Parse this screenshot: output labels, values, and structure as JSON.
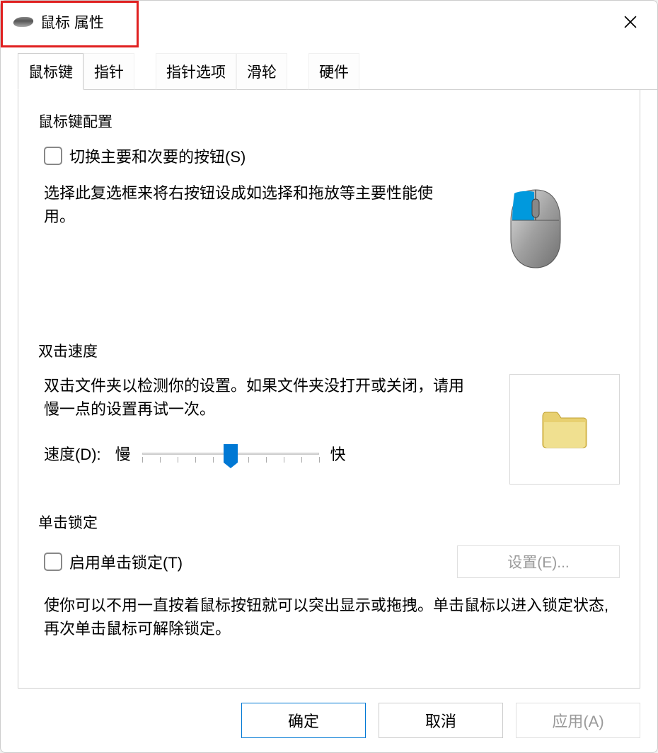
{
  "window": {
    "title": "鼠标 属性"
  },
  "tabs": [
    {
      "label": "鼠标键",
      "active": true
    },
    {
      "label": "指针",
      "active": false
    },
    {
      "label": "指针选项",
      "active": false
    },
    {
      "label": "滑轮",
      "active": false
    },
    {
      "label": "硬件",
      "active": false
    }
  ],
  "buttons_config": {
    "title": "鼠标键配置",
    "checkbox_label": "切换主要和次要的按钮(S)",
    "description": "选择此复选框来将右按钮设成如选择和拖放等主要性能使用。"
  },
  "double_click": {
    "title": "双击速度",
    "description": "双击文件夹以检测你的设置。如果文件夹没打开或关闭，请用慢一点的设置再试一次。",
    "speed_label": "速度(D):",
    "slow_label": "慢",
    "fast_label": "快",
    "slider_value": 5,
    "slider_max": 10
  },
  "click_lock": {
    "title": "单击锁定",
    "checkbox_label": "启用单击锁定(T)",
    "settings_label": "设置(E)...",
    "description": "使你可以不用一直按着鼠标按钮就可以突出显示或拖拽。单击鼠标以进入锁定状态,再次单击鼠标可解除锁定。"
  },
  "footer": {
    "ok": "确定",
    "cancel": "取消",
    "apply": "应用(A)"
  }
}
